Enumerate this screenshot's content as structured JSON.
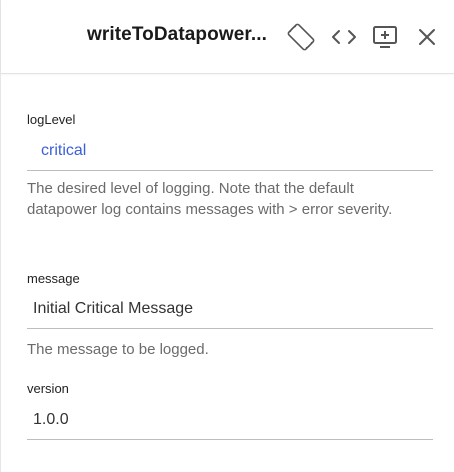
{
  "header": {
    "title": "writeToDatapower...",
    "icons": [
      "rotate-icon",
      "code-icon",
      "add-screen-icon",
      "close-icon"
    ]
  },
  "fields": [
    {
      "label": "logLevel",
      "value": "critical",
      "help": "The desired level of logging. Note that the default datapower log contains messages with > error severity."
    },
    {
      "label": "message",
      "value": "Initial Critical Message",
      "help": "The message to be logged."
    },
    {
      "label": "version",
      "value": "1.0.0"
    }
  ],
  "colors": {
    "link": "#3b5fd9",
    "help_text": "#6b6b6b",
    "divider": "#bdbdbd",
    "icon": "#555555"
  }
}
